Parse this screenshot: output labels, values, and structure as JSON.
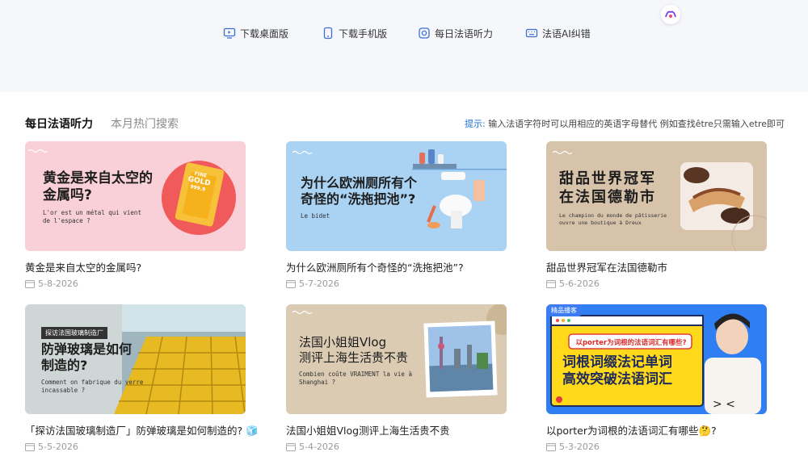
{
  "topnav": {
    "items": [
      {
        "label": "下载桌面版",
        "icon": "desktop-icon"
      },
      {
        "label": "下载手机版",
        "icon": "mobile-icon"
      },
      {
        "label": "每日法语听力",
        "icon": "listening-icon"
      },
      {
        "label": "法语AI纠错",
        "icon": "keyboard-icon"
      }
    ]
  },
  "section": {
    "tab_active": "每日法语听力",
    "tab_inactive": "本月热门搜索",
    "tip_label": "提示:",
    "tip_text": "输入法语字符时可以用相应的英语字母替代 例如查找être只需输入etre即可"
  },
  "cards": [
    {
      "title": "黄金是来自太空的金属吗?",
      "date": "5-8-2026",
      "thumb": {
        "heading": [
          "黄金是来自太空的",
          "金属吗?"
        ],
        "sub": [
          "L'or est un métal qui vient",
          "de l'espace ?"
        ],
        "bg": "#f9cfd8",
        "bar_text": [
          "FINE",
          "GOLD",
          "999.9"
        ]
      }
    },
    {
      "title": "为什么欧洲厕所有个奇怪的“洗拖把池”?",
      "date": "5-7-2026",
      "thumb": {
        "heading": [
          "为什么欧洲厕所有个",
          "奇怪的“洗拖把池”?"
        ],
        "sub": [
          "Le bidet"
        ],
        "bg": "#a9d2f3"
      }
    },
    {
      "title": "甜品世界冠军在法国德勒市",
      "date": "5-6-2026",
      "thumb": {
        "heading": [
          "甜品世界冠军",
          "在法国德勒市"
        ],
        "sub": [
          "Le champion du monde de pâtisserie",
          "ouvre une boutique à Dreux"
        ],
        "bg": "#d7c2aa"
      }
    },
    {
      "title": "「探访法国玻璃制造厂」防弹玻璃是如何制造的? 🧊",
      "date": "5-5-2026",
      "thumb": {
        "strip": "探访法国玻璃制造厂",
        "heading": [
          "防弹玻璃是如何",
          "制造的?"
        ],
        "sub": [
          "Comment on fabrique du verre",
          "incassable ?"
        ],
        "bg": "#cfd6d6"
      }
    },
    {
      "title": "法国小姐姐Vlog测评上海生活贵不贵",
      "date": "5-4-2026",
      "thumb": {
        "heading": [
          "法国小姐姐Vlog",
          "测评上海生活贵不贵"
        ],
        "sub": [
          "Combien coûte VRAIMENT la vie à",
          "Shanghai ?"
        ],
        "bg": "#dacbb2"
      }
    },
    {
      "title": "以porter为词根的法语词汇有哪些🤔?",
      "date": "5-3-2026",
      "thumb": {
        "tag": "精品播客",
        "box_line": "以porter为词根的法语词汇有哪些?",
        "heading": [
          "词根词缀法记单词",
          "高效突破法语词汇"
        ],
        "bg": "#2f7ff2"
      }
    }
  ],
  "colors": {
    "accent_blue": "#1e6fd9",
    "topbar_bg": "#f6f7fb",
    "date_gray": "#9a9a9a"
  }
}
